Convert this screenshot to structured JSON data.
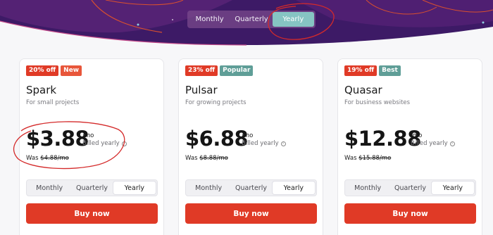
{
  "colors": {
    "accent": "#e03a26",
    "teal": "#86c4c3",
    "hero": "#4b1f6e"
  },
  "period_toggle": {
    "options": [
      "Monthly",
      "Quarterly",
      "Yearly"
    ],
    "selected": "Yearly"
  },
  "plans": [
    {
      "badges": [
        "20% off",
        "New"
      ],
      "name": "Spark",
      "description": "For small projects",
      "price": "$3.88",
      "per": "/mo",
      "billed": "Billed yearly",
      "was_label": "Was",
      "was_price": "$4.88/mo",
      "toggle": [
        "Monthly",
        "Quarterly",
        "Yearly"
      ],
      "button": "Buy now"
    },
    {
      "badges": [
        "23% off",
        "Popular"
      ],
      "name": "Pulsar",
      "description": "For growing projects",
      "price": "$6.88",
      "per": "/mo",
      "billed": "Billed yearly",
      "was_label": "Was",
      "was_price": "$8.88/mo",
      "toggle": [
        "Monthly",
        "Quarterly",
        "Yearly"
      ],
      "button": "Buy now"
    },
    {
      "badges": [
        "19% off",
        "Best"
      ],
      "name": "Quasar",
      "description": "For business websites",
      "price": "$12.88",
      "per": "/mo",
      "billed": "Billed yearly",
      "was_label": "Was",
      "was_price": "$15.88/mo",
      "toggle": [
        "Monthly",
        "Quarterly",
        "Yearly"
      ],
      "button": "Buy now"
    }
  ]
}
